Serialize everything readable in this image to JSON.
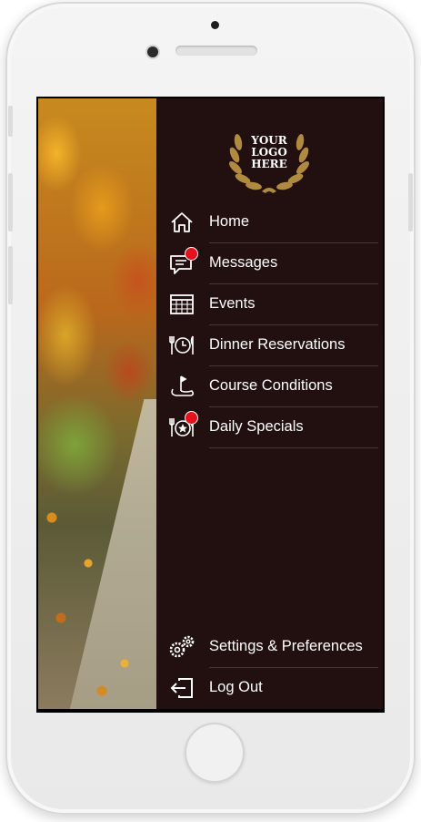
{
  "logo": {
    "lines": [
      "YOUR",
      "LOGO",
      "HERE"
    ],
    "color": "#b08a3e"
  },
  "menu": {
    "items": [
      {
        "label": "Home",
        "icon": "home-icon",
        "badge": false
      },
      {
        "label": "Messages",
        "icon": "messages-icon",
        "badge": true
      },
      {
        "label": "Events",
        "icon": "calendar-icon",
        "badge": false
      },
      {
        "label": "Dinner Reservations",
        "icon": "dinner-clock-icon",
        "badge": false
      },
      {
        "label": "Course Conditions",
        "icon": "golf-flag-icon",
        "badge": false
      },
      {
        "label": "Daily Specials",
        "icon": "specials-icon",
        "badge": true
      }
    ],
    "bottom_items": [
      {
        "label": "Settings & Preferences",
        "icon": "gears-icon"
      },
      {
        "label": "Log Out",
        "icon": "logout-icon"
      }
    ]
  },
  "colors": {
    "menu_background": "#221010",
    "badge": "#e3121b",
    "separator": "#4a3434"
  }
}
